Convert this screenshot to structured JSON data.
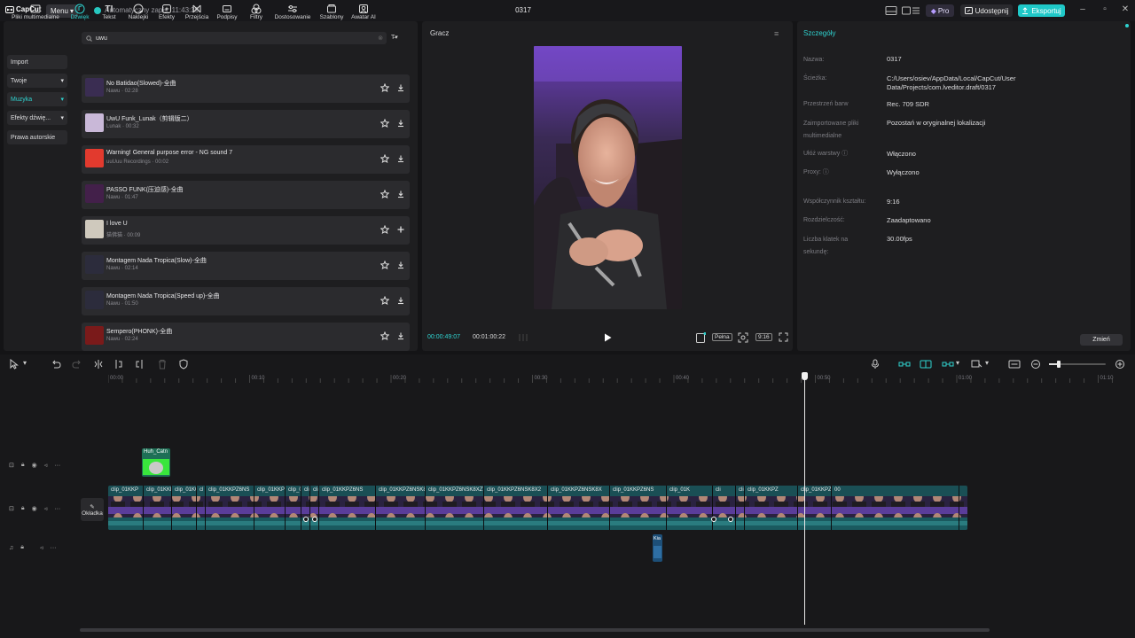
{
  "topbar": {
    "app_name": "CapCut",
    "menu_label": "Menu",
    "autosave_text": "Automatyczny zapis: 11:43:39",
    "project_title": "0317",
    "pro_label": "Pro",
    "share_label": "Udostępnij",
    "export_label": "Eksportuj",
    "accent_color": "#1fc8c8"
  },
  "toolbar": {
    "items": [
      {
        "label": "Pliki multimedialne",
        "icon": "media-icon"
      },
      {
        "label": "Dźwięk",
        "icon": "audio-icon",
        "active": true
      },
      {
        "label": "Tekst",
        "icon": "text-icon"
      },
      {
        "label": "Naklejki",
        "icon": "sticker-icon"
      },
      {
        "label": "Efekty",
        "icon": "effects-icon"
      },
      {
        "label": "Przejścia",
        "icon": "transition-icon"
      },
      {
        "label": "Podpisy",
        "icon": "captions-icon"
      },
      {
        "label": "Filtry",
        "icon": "filter-icon"
      },
      {
        "label": "Dostosowanie",
        "icon": "adjust-icon"
      },
      {
        "label": "Szablony",
        "icon": "templates-icon"
      },
      {
        "label": "Awatar AI",
        "icon": "avatar-icon"
      }
    ]
  },
  "sidebar": {
    "items": [
      {
        "label": "Import"
      },
      {
        "label": "Twoje",
        "chevron": true
      },
      {
        "label": "Muzyka",
        "chevron": true,
        "active": true
      },
      {
        "label": "Efekty dźwię...",
        "chevron": true
      },
      {
        "label": "Prawa autorskie"
      }
    ]
  },
  "search": {
    "value": "uwu"
  },
  "tracks": [
    {
      "name": "No Batidao(Slowed)-全曲",
      "meta": "Nawu · 02:28",
      "action": "download",
      "thumb": "#3a2d52"
    },
    {
      "name": "UwU Funk_Lunak（剪辑版二）",
      "meta": "Lunak · 00:32",
      "action": "download",
      "thumb": "#c9b8d8"
    },
    {
      "name": "Warning! General purpose error - NG sound 7",
      "meta": "uuUuu Recordings · 00:02",
      "action": "download",
      "thumb": "#e23a2e"
    },
    {
      "name": "PASSO FUNK(压迫感)-全曲",
      "meta": "Nawu · 01:47",
      "action": "download",
      "thumb": "#43204a"
    },
    {
      "name": "I love U",
      "meta": "猫佛猫 · 00:09",
      "action": "add",
      "thumb": "#cfc9bd"
    },
    {
      "name": "Montagem Nada Tropica(Slow)-全曲",
      "meta": "Nawu · 02:14",
      "action": "download",
      "thumb": "#2c2c3c"
    },
    {
      "name": "Montagem Nada Tropica(Speed up)-全曲",
      "meta": "Nawu · 01:50",
      "action": "download",
      "thumb": "#2c2c3c"
    },
    {
      "name": "Sempero(PHONK)-全曲",
      "meta": "Nawu · 02:24",
      "action": "download",
      "thumb": "#7a1a1a"
    }
  ],
  "player": {
    "title": "Gracz",
    "time_current": "00:00:49:07",
    "time_total": "00:01:00:22",
    "full_label": "Pełna",
    "ratio_label": "9:16"
  },
  "details": {
    "title": "Szczegóły",
    "rows": [
      {
        "label": "Nazwa:",
        "value": "0317"
      },
      {
        "label": "Ścieżka:",
        "value": "C:/Users/osiev/AppData/Local/CapCut/User Data/Projects/com.lveditor.draft/0317"
      },
      {
        "label": "Przestrzeń barw",
        "value": "Rec. 709 SDR"
      },
      {
        "label": "Zaimportowane pliki multimedialne",
        "value": "Pozostań w oryginalnej lokalizacji"
      },
      {
        "label": "Ułóż warstwy",
        "value": "Włączono"
      },
      {
        "label": "Proxy:",
        "value": "Wyłączono"
      },
      {
        "label": "Współczynnik kształtu:",
        "value": "9:16"
      },
      {
        "label": "Rozdzielczość:",
        "value": "Zaadaptowano"
      },
      {
        "label": "Liczba klatek na sekundę:",
        "value": "30.00fps"
      }
    ],
    "change_label": "Zmień"
  },
  "timeline": {
    "ticks": [
      "00:00",
      "00:10",
      "00:20",
      "00:30",
      "00:40",
      "00:50",
      "01:00",
      "01:10"
    ],
    "cover_label": "Okładka",
    "sticker_clip_label": "Huh_Catn",
    "audio_clip_label": "Kia",
    "main_clips": [
      "clip_01KKP",
      "clip_01KKl",
      "clip_01K0",
      "cl",
      "clip_01KKPZ6NS",
      "clip_01KKP",
      "clip_0",
      "cli",
      "clip_01KKPZ6NSK8",
      "clip_01KKPZ6NS",
      "clip_01KKPZ6NSK8XZ",
      "clip_01KKPZ6NSK8XZT",
      "clip_01KKPZ6NSK8X2",
      "clip_01KKPZ6NSK8X",
      "clip_01KKPZ6NS",
      "clip_01K",
      "cli",
      "clip_01KKPZ6NS",
      "clip_01KKPZ",
      "clip_01KKPZ6NSK8XZTSCYAPPVMT0KJ.mp4",
      "00"
    ]
  }
}
